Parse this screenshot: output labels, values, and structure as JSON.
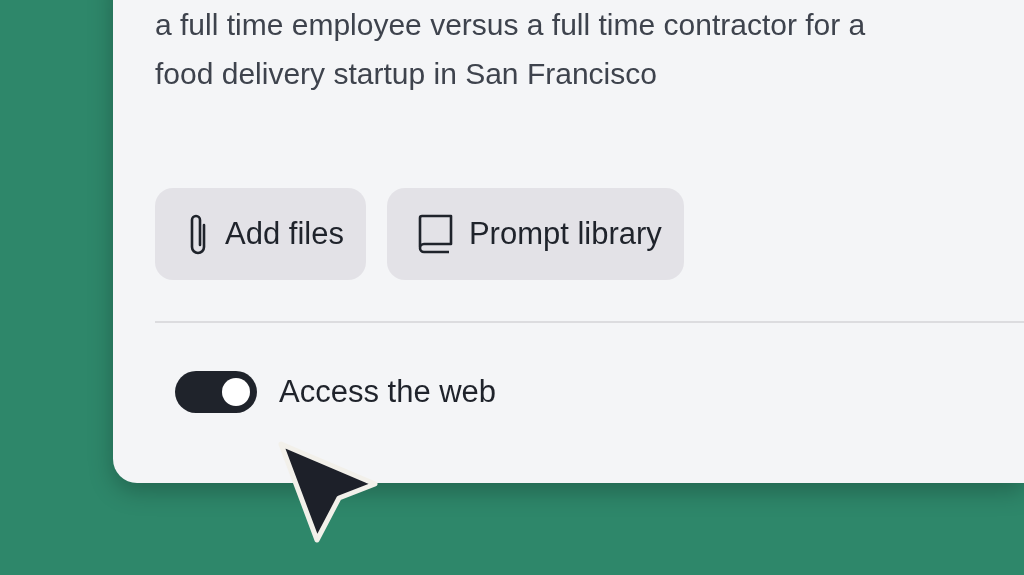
{
  "prompt_lines": [
    "a full time employee versus a full time contractor for a",
    "food delivery startup in San Francisco"
  ],
  "buttons": [
    {
      "kind": "attach",
      "label": "Add files"
    },
    {
      "kind": "library",
      "label": "Prompt library"
    }
  ],
  "web_toggle": {
    "label": "Access the web",
    "on": true
  }
}
